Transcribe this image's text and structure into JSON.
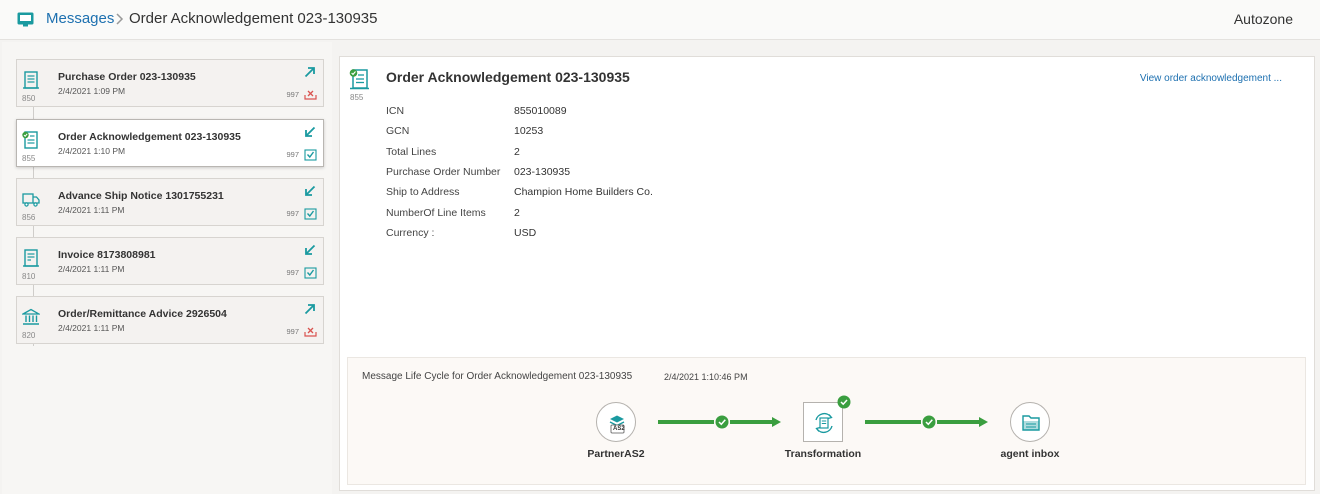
{
  "header": {
    "breadcrumb_root": "Messages",
    "breadcrumb_current": "Order Acknowledgement 023-130935",
    "organization": "Autozone"
  },
  "messages": [
    {
      "code": "850",
      "title": "Purchase Order  023-130935",
      "date": "2/4/2021 1:09 PM",
      "direction": "outbound",
      "ack_code": "997",
      "ack_status": "error"
    },
    {
      "code": "855",
      "title": "Order Acknowledgement  023-130935",
      "date": "2/4/2021 1:10 PM",
      "direction": "inbound",
      "ack_code": "997",
      "ack_status": "ok"
    },
    {
      "code": "856",
      "title": "Advance Ship Notice  1301755231",
      "date": "2/4/2021 1:11 PM",
      "direction": "inbound",
      "ack_code": "997",
      "ack_status": "ok"
    },
    {
      "code": "810",
      "title": "Invoice  8173808981",
      "date": "2/4/2021 1:11 PM",
      "direction": "inbound",
      "ack_code": "997",
      "ack_status": "ok"
    },
    {
      "code": "820",
      "title": "Order/Remittance Advice  2926504",
      "date": "2/4/2021 1:11 PM",
      "direction": "outbound",
      "ack_code": "997",
      "ack_status": "error"
    }
  ],
  "detail": {
    "code": "855",
    "title": "Order Acknowledgement 023-130935",
    "view_link": "View order acknowledgement ...",
    "fields": [
      {
        "label": "ICN",
        "value": "855010089"
      },
      {
        "label": "GCN",
        "value": "10253"
      },
      {
        "label": "Total Lines",
        "value": "2"
      },
      {
        "label": "Purchase Order Number",
        "value": "023-130935"
      },
      {
        "label": "Ship to Address",
        "value": "Champion Home Builders Co."
      },
      {
        "label": "NumberOf Line Items",
        "value": "2"
      },
      {
        "label": "Currency :",
        "value": "USD"
      }
    ]
  },
  "lifecycle": {
    "title": "Message Life Cycle for Order Acknowledgement 023-130935",
    "timestamp": "2/4/2021 1:10:46 PM",
    "nodes": [
      {
        "label": "PartnerAS2",
        "icon": "as2-icon",
        "icon_text": "AS2"
      },
      {
        "label": "Transformation",
        "icon": "transformation-icon"
      },
      {
        "label": "agent inbox",
        "icon": "inbox-folder-icon"
      }
    ]
  },
  "colors": {
    "accent_teal": "#1a9aa0",
    "link_blue": "#1d70b0",
    "success_green": "#3a9e3f",
    "error_red": "#d9534f"
  }
}
